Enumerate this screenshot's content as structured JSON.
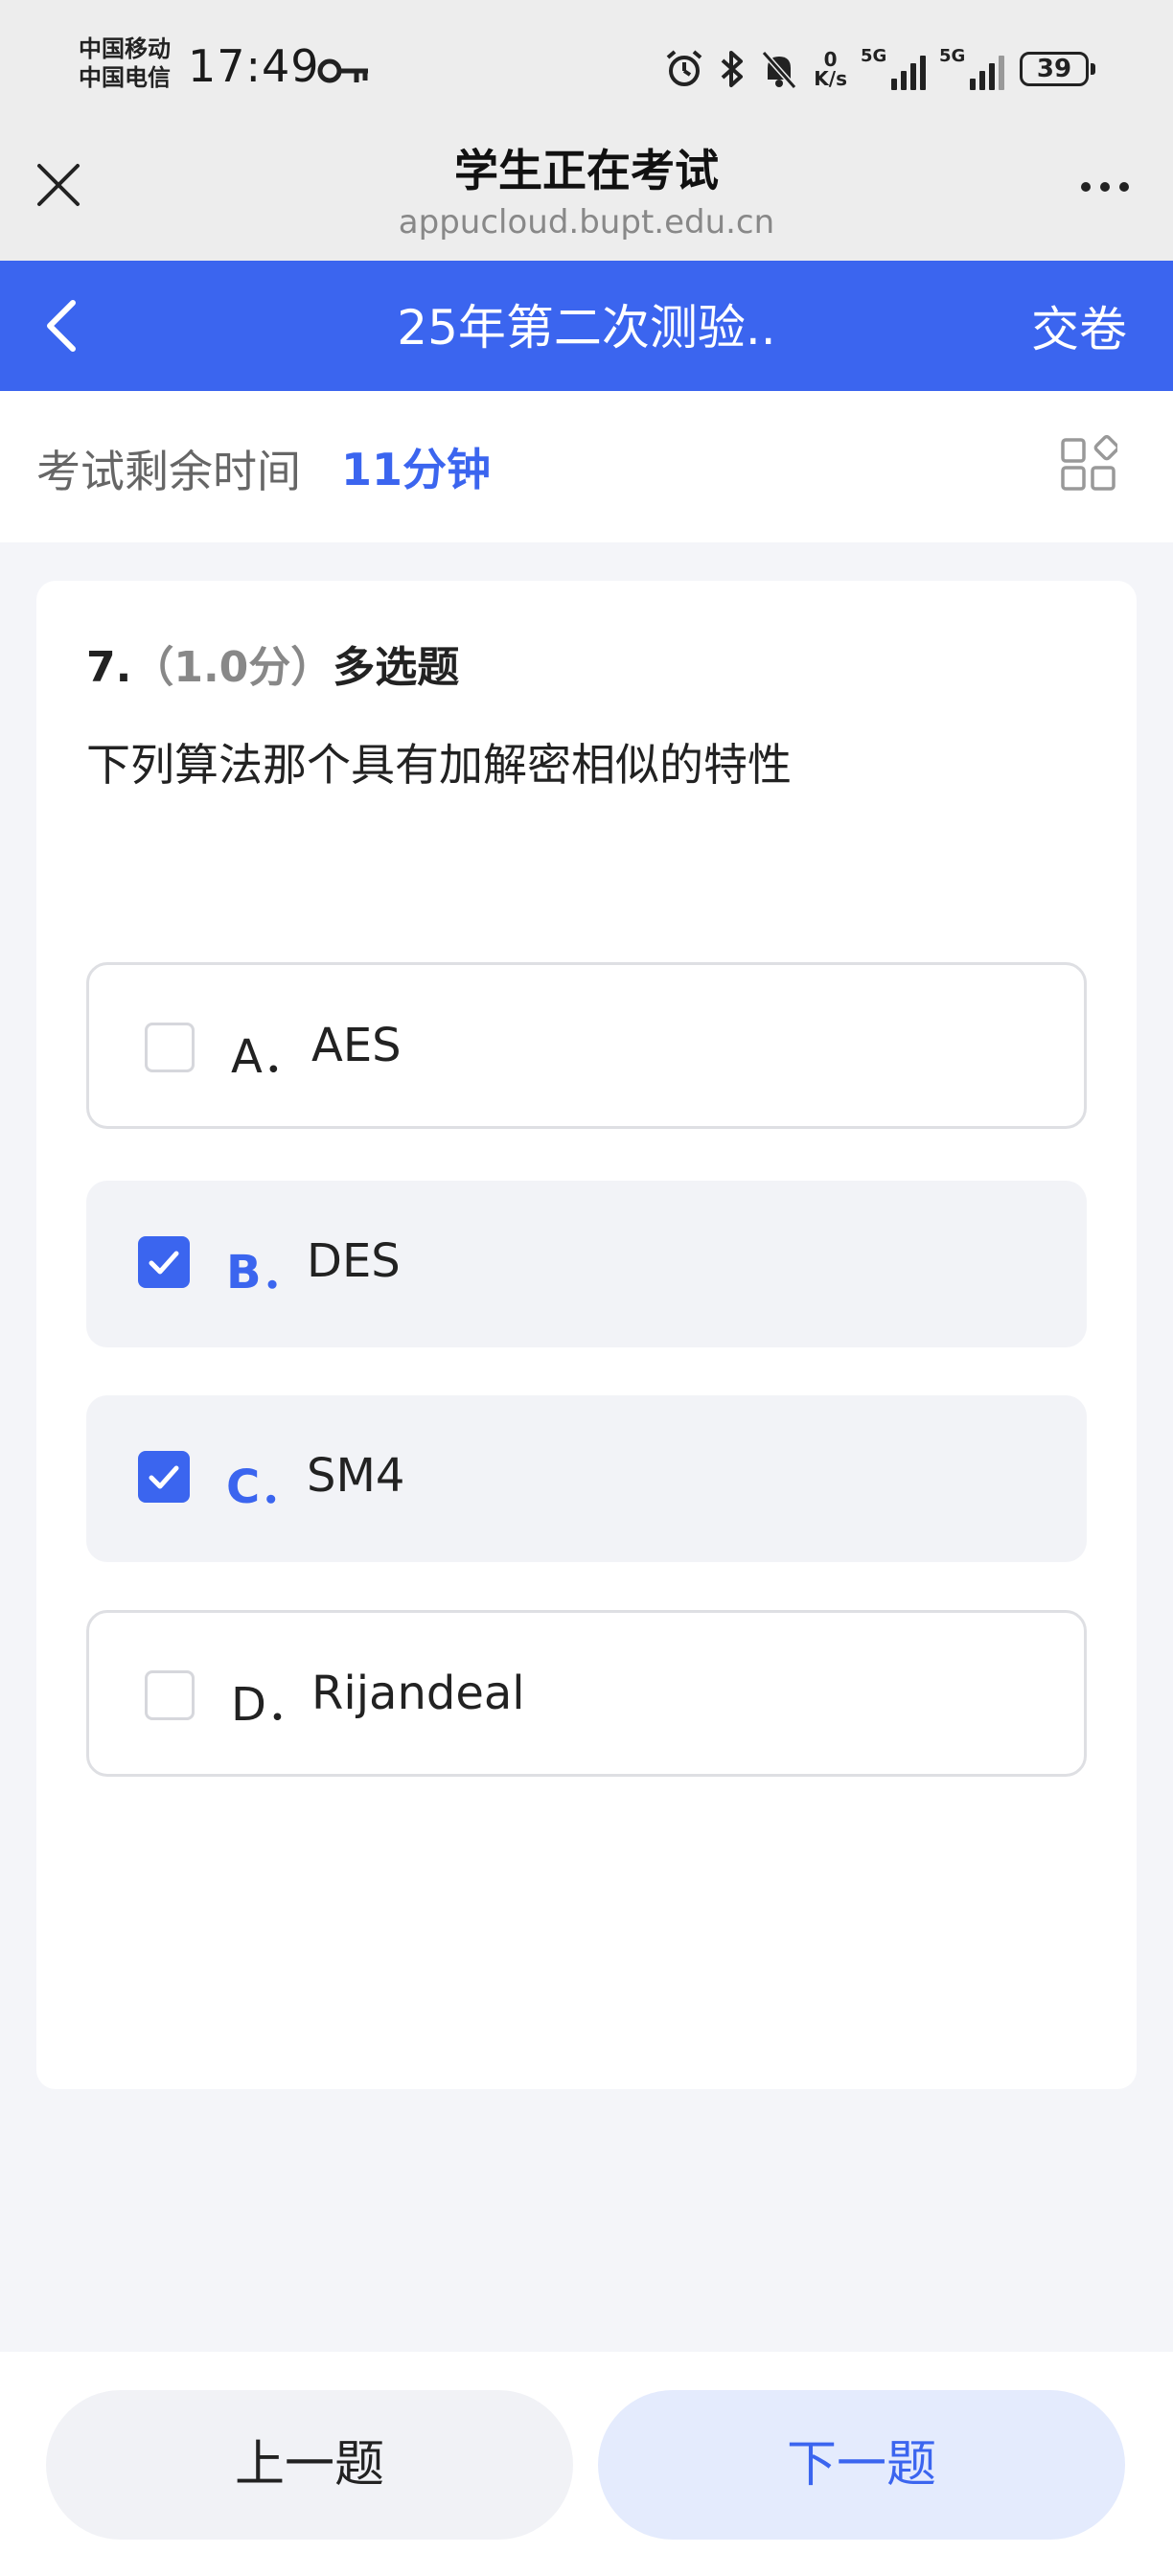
{
  "status_bar": {
    "carrier_1": "中国移动",
    "carrier_2": "中国电信",
    "time": "17:49",
    "net_speed_value": "0",
    "net_speed_unit": "K/s",
    "sim1_label": "5G",
    "sim2_label": "5G",
    "battery": "39"
  },
  "browser": {
    "title": "学生正在考试",
    "url": "appucloud.bupt.edu.cn"
  },
  "exam_header": {
    "title": "25年第二次测验..",
    "submit_label": "交卷"
  },
  "timer": {
    "label": "考试剩余时间",
    "value": "11分钟"
  },
  "question": {
    "number": "7.",
    "score": "（1.0分）",
    "type": "多选题",
    "text": "下列算法那个具有加解密相似的特性",
    "options": [
      {
        "letter": "A．",
        "text": "AES",
        "selected": false
      },
      {
        "letter": "B．",
        "text": "DES",
        "selected": true
      },
      {
        "letter": "C．",
        "text": "SM4",
        "selected": true
      },
      {
        "letter": "D．",
        "text": "Rijandeal",
        "selected": false
      }
    ]
  },
  "nav": {
    "prev_label": "上一题",
    "next_label": "下一题"
  },
  "colors": {
    "accent": "#3b65ef",
    "header_bg": "#ededed",
    "page_bg": "#f4f5f9"
  }
}
